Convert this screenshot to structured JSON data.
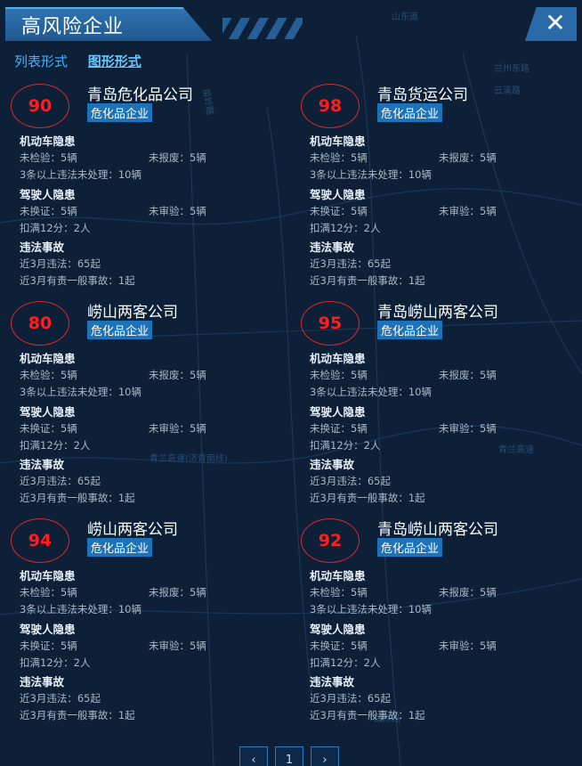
{
  "header": {
    "title": "高风险企业",
    "close_symbol": "✕"
  },
  "view_tabs": {
    "list": "列表形式",
    "graph": "图形形式"
  },
  "labels": {
    "vehicle_hazard": "机动车隐患",
    "driver_hazard": "驾驶人隐患",
    "violation": "违法事故"
  },
  "map_labels": [
    "山东道",
    "苗岭路",
    "兰州东路",
    "云溪路",
    "青兰高速(济青南线)",
    "青兰高速",
    "国际路"
  ],
  "cards": [
    {
      "score": "90",
      "company": "青岛危化品公司",
      "tag": "危化品企业",
      "v_inspect": "未检验：5辆",
      "v_scrap": "未报废：5辆",
      "v_unhandled": "3条以上违法未处理：10辆",
      "d_renew": "未换证：5辆",
      "d_review": "未审验：5辆",
      "d_points": "扣满12分：2人",
      "x_recent": "近3月违法：65起",
      "x_accident": "近3月有责一般事故：1起"
    },
    {
      "score": "98",
      "company": "青岛货运公司",
      "tag": "危化品企业",
      "v_inspect": "未检验：5辆",
      "v_scrap": "未报废：5辆",
      "v_unhandled": "3条以上违法未处理：10辆",
      "d_renew": "未换证：5辆",
      "d_review": "未审验：5辆",
      "d_points": "扣满12分：2人",
      "x_recent": "近3月违法：65起",
      "x_accident": "近3月有责一般事故：1起"
    },
    {
      "score": "80",
      "company": "崂山两客公司",
      "tag": "危化品企业",
      "v_inspect": "未检验：5辆",
      "v_scrap": "未报废：5辆",
      "v_unhandled": "3条以上违法未处理：10辆",
      "d_renew": "未换证：5辆",
      "d_review": "未审验：5辆",
      "d_points": "扣满12分：2人",
      "x_recent": "近3月违法：65起",
      "x_accident": "近3月有责一般事故：1起"
    },
    {
      "score": "95",
      "company": "青岛崂山两客公司",
      "tag": "危化品企业",
      "v_inspect": "未检验：5辆",
      "v_scrap": "未报废：5辆",
      "v_unhandled": "3条以上违法未处理：10辆",
      "d_renew": "未换证：5辆",
      "d_review": "未审验：5辆",
      "d_points": "扣满12分：2人",
      "x_recent": "近3月违法：65起",
      "x_accident": "近3月有责一般事故：1起"
    },
    {
      "score": "94",
      "company": "崂山两客公司",
      "tag": "危化品企业",
      "v_inspect": "未检验：5辆",
      "v_scrap": "未报废：5辆",
      "v_unhandled": "3条以上违法未处理：10辆",
      "d_renew": "未换证：5辆",
      "d_review": "未审验：5辆",
      "d_points": "扣满12分：2人",
      "x_recent": "近3月违法：65起",
      "x_accident": "近3月有责一般事故：1起"
    },
    {
      "score": "92",
      "company": "青岛崂山两客公司",
      "tag": "危化品企业",
      "v_inspect": "未检验：5辆",
      "v_scrap": "未报废：5辆",
      "v_unhandled": "3条以上违法未处理：10辆",
      "d_renew": "未换证：5辆",
      "d_review": "未审验：5辆",
      "d_points": "扣满12分：2人",
      "x_recent": "近3月违法：65起",
      "x_accident": "近3月有责一般事故：1起"
    }
  ],
  "pager": {
    "prev": "‹",
    "current": "1",
    "next": "›"
  },
  "colors": {
    "background": "#0d2038",
    "accent": "#2b6aa8",
    "score_red": "#ff1e1e",
    "badge_blue": "#1d72b8"
  }
}
